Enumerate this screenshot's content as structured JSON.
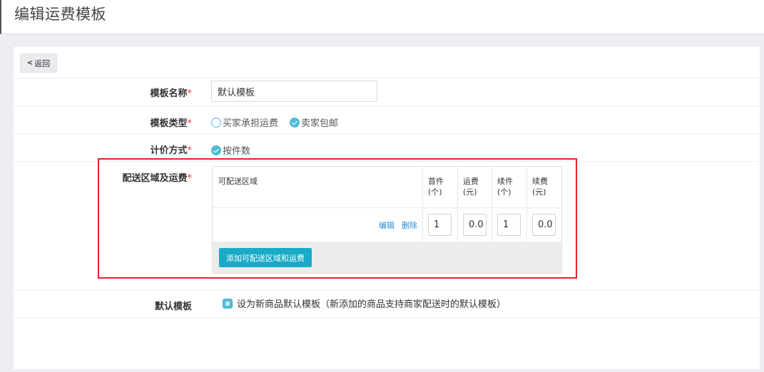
{
  "header": {
    "title": "编辑运费模板"
  },
  "back_button": {
    "label": "返回",
    "icon": "chevron-left-icon"
  },
  "form": {
    "template_name": {
      "label": "模板名称",
      "required": "*",
      "value": "默认模板"
    },
    "template_type": {
      "label": "模板类型",
      "required": "*",
      "options": [
        {
          "label": "买家承担运费",
          "checked": false
        },
        {
          "label": "卖家包邮",
          "checked": true
        }
      ]
    },
    "pricing": {
      "label": "计价方式",
      "required": "*",
      "options": [
        {
          "label": "按件数",
          "checked": true
        }
      ]
    },
    "shipping": {
      "label": "配送区域及运费",
      "required": "*",
      "headers": {
        "region": "可配送区域",
        "first_item": "首件\n(个)",
        "first_fee": "运费\n(元)",
        "extra_item": "续件\n(个)",
        "extra_fee": "续费\n(元)"
      },
      "row": {
        "edit": "编辑",
        "delete": "删除",
        "first_item": "1",
        "first_fee": "0.0",
        "extra_item": "1",
        "extra_fee": "0.0"
      },
      "add_button": "添加可配送区域和运费"
    },
    "default_template": {
      "label": "默认模板",
      "checkbox_label": "设为新商品默认模板（新添加的商品支持商家配送时的默认模板）",
      "checked": true
    }
  },
  "colors": {
    "accent": "#18aac6",
    "radio": "#51bcd6",
    "highlight_border": "#e0242a",
    "link": "#2a8fd6",
    "required": "#e4393c"
  }
}
